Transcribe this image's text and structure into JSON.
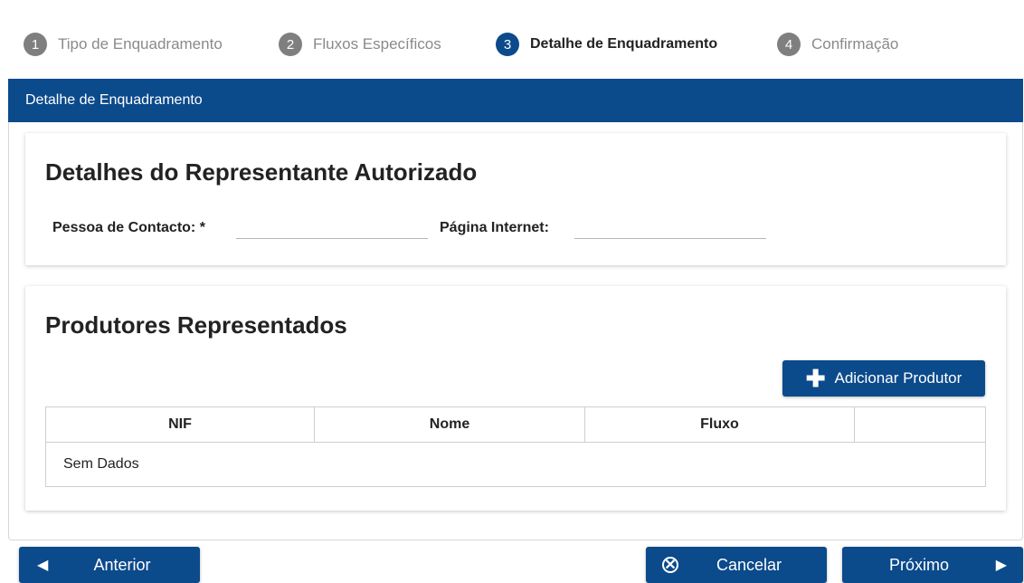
{
  "stepper": {
    "steps": [
      {
        "number": "1",
        "label": "Tipo de Enquadramento",
        "state": "completed"
      },
      {
        "number": "2",
        "label": "Fluxos Específicos",
        "state": "completed"
      },
      {
        "number": "3",
        "label": "Detalhe de Enquadramento",
        "state": "active"
      },
      {
        "number": "4",
        "label": "Confirmação",
        "state": "pending"
      }
    ]
  },
  "panel": {
    "title": "Detalhe de Enquadramento"
  },
  "representante": {
    "title": "Detalhes do Representante Autorizado",
    "contact_label": "Pessoa de Contacto: *",
    "contact_value": "",
    "website_label": "Página Internet:",
    "website_value": ""
  },
  "produtores": {
    "title": "Produtores Representados",
    "add_button_label": "Adicionar Produtor",
    "add_button_icon": "plus-icon",
    "table": {
      "columns": [
        "NIF",
        "Nome",
        "Fluxo",
        ""
      ],
      "empty_text": "Sem Dados"
    }
  },
  "footer": {
    "prev_label": "Anterior",
    "prev_icon": "triangle-left-icon",
    "cancel_label": "Cancelar",
    "cancel_icon": "close-circle-icon",
    "next_label": "Próximo",
    "next_icon": "triangle-right-icon"
  },
  "colors": {
    "primary": "#0b4a8b",
    "step_inactive": "#7f7f7f",
    "muted_text": "#8a8a8a"
  }
}
